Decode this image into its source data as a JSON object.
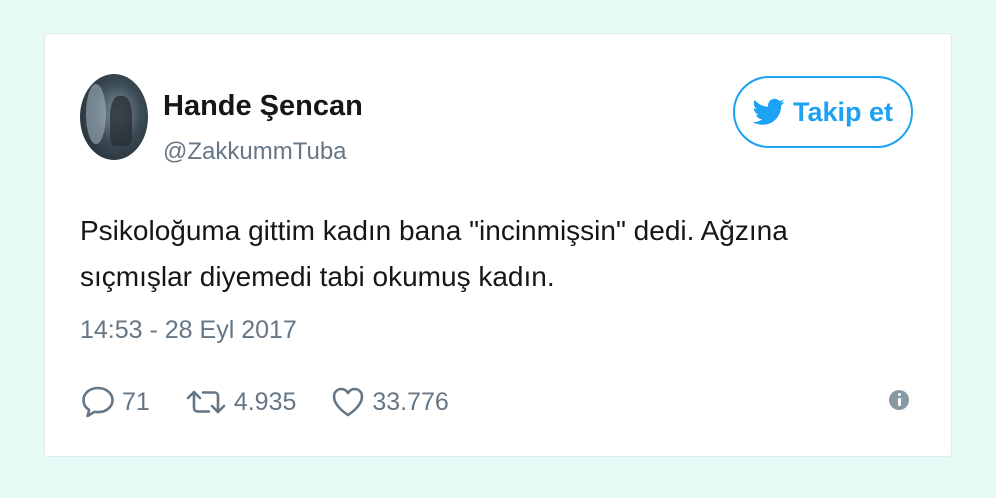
{
  "tweet": {
    "author": {
      "display_name": "Hande Şencan",
      "handle": "@ZakkummTuba"
    },
    "follow_button": {
      "label": "Takip et",
      "icon": "twitter-bird-icon"
    },
    "text_lines": [
      "Psikoloğuma gittim kadın bana \"incinmişsin\" dedi. Ağzına",
      "sıçmışlar diyemedi tabi okumuş kadın."
    ],
    "timestamp": "14:53 - 28 Eyl 2017",
    "actions": {
      "replies": {
        "icon": "reply-icon",
        "count": "71"
      },
      "retweets": {
        "icon": "retweet-icon",
        "count": "4.935"
      },
      "likes": {
        "icon": "heart-icon",
        "count": "33.776"
      },
      "info": {
        "icon": "info-icon"
      }
    }
  },
  "colors": {
    "background": "#e6fbf5",
    "card": "#ffffff",
    "accent": "#1da1f2",
    "text": "#14171a",
    "muted": "#657786"
  }
}
